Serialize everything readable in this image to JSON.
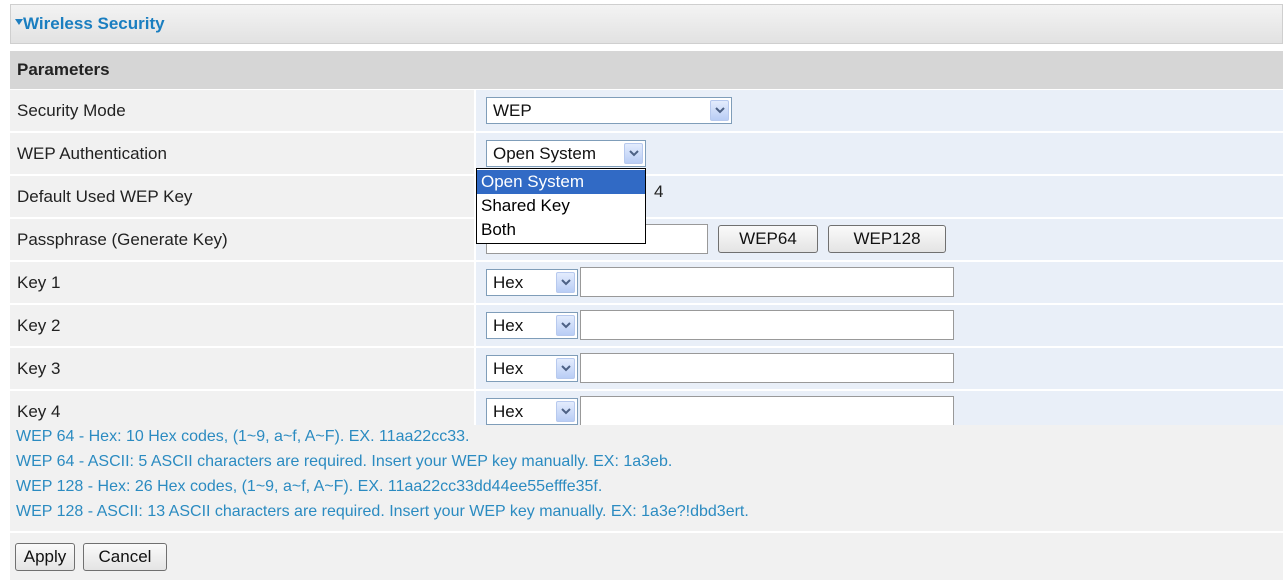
{
  "header": {
    "title": "Wireless Security"
  },
  "section": {
    "title": "Parameters"
  },
  "rows": {
    "security_mode": {
      "label": "Security Mode",
      "value": "WEP"
    },
    "wep_auth": {
      "label": "WEP Authentication",
      "value": "Open System"
    },
    "default_key": {
      "label": "Default Used WEP Key",
      "visible_value_fragment": "4"
    },
    "passphrase": {
      "label": "Passphrase (Generate Key)",
      "value": "",
      "btn_wep64": "WEP64",
      "btn_wep128": "WEP128"
    },
    "keys": [
      {
        "label": "Key 1",
        "format": "Hex",
        "value": ""
      },
      {
        "label": "Key 2",
        "format": "Hex",
        "value": ""
      },
      {
        "label": "Key 3",
        "format": "Hex",
        "value": ""
      },
      {
        "label": "Key 4",
        "format": "Hex",
        "value": ""
      }
    ]
  },
  "dropdown": {
    "options": [
      "Open System",
      "Shared Key",
      "Both"
    ],
    "selected": "Open System"
  },
  "notes": [
    "WEP 64 - Hex: 10 Hex codes, (1~9, a~f, A~F). EX. 11aa22cc33.",
    "WEP 64 - ASCII: 5 ASCII characters are required. Insert your WEP key manually. EX: 1a3eb.",
    "WEP 128 - Hex: 26 Hex codes, (1~9, a~f, A~F). EX. 11aa22cc33dd44ee55efffe35f.",
    "WEP 128 - ASCII: 13 ASCII characters are required. Insert your WEP key manually. EX: 1a3e?!dbd3ert."
  ],
  "footer": {
    "apply": "Apply",
    "cancel": "Cancel"
  },
  "colors": {
    "title": "#1a7ec0",
    "note_text": "#2b8bc1",
    "value_bg": "#e9eff8",
    "label_bg": "#f1f1f1",
    "selected_option": "#316ac5"
  },
  "icons": {
    "section_toggle": "triangle-down-icon",
    "select_arrow": "chevron-down-icon"
  }
}
